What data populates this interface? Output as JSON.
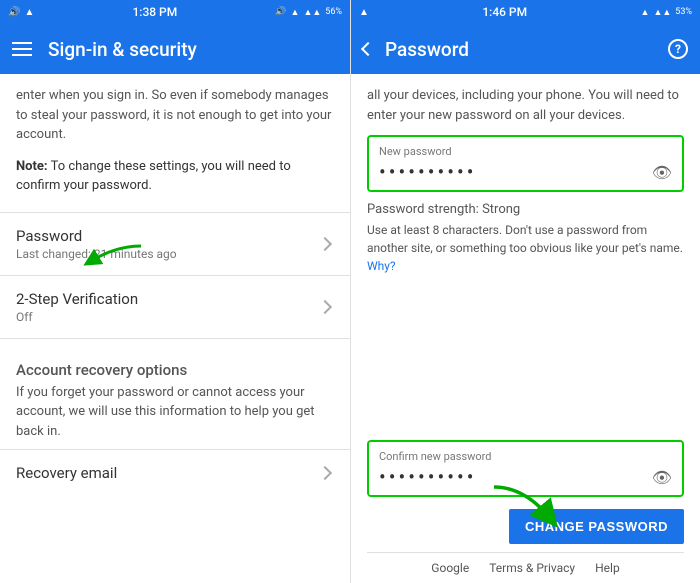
{
  "left": {
    "status": {
      "left": "🔊 ▲",
      "time": "1:38 PM",
      "right": "🔊 ▲ ▲▲ 56%"
    },
    "header": {
      "title": "Sign-in & security"
    },
    "intro": "enter when you sign in. So even if somebody manages to steal your password, it is not enough to get into your account.",
    "note": "To change these settings, you will need to confirm your password.",
    "menu_items": [
      {
        "title": "Password",
        "subtitle": "Last changed: 21 minutes ago"
      },
      {
        "title": "2-Step Verification",
        "subtitle": "Off"
      }
    ],
    "account_recovery": {
      "title": "Account recovery options",
      "desc": "If you forget your password or cannot access your account, we will use this information to help you get back in."
    },
    "recovery_email": {
      "title": "Recovery email"
    }
  },
  "right": {
    "status": {
      "left": "▲",
      "time": "1:46 PM",
      "right": "▲ ▲▲ 53%"
    },
    "header": {
      "title": "Password"
    },
    "info_text": "all your devices, including your phone. You will need to enter your new password on all your devices.",
    "new_password_label": "New password",
    "new_password_dots": "••••••••••",
    "strength_label": "Password strength:",
    "strength_value": "Strong",
    "strength_desc": "Use at least 8 characters. Don't use a password from another site, or something too obvious like your pet's name.",
    "why_text": "Why?",
    "confirm_label": "Confirm new password",
    "confirm_dots": "••••••••••",
    "change_btn": "CHANGE PASSWORD",
    "footer": {
      "links": [
        "Google",
        "Terms & Privacy",
        "Help"
      ]
    }
  }
}
